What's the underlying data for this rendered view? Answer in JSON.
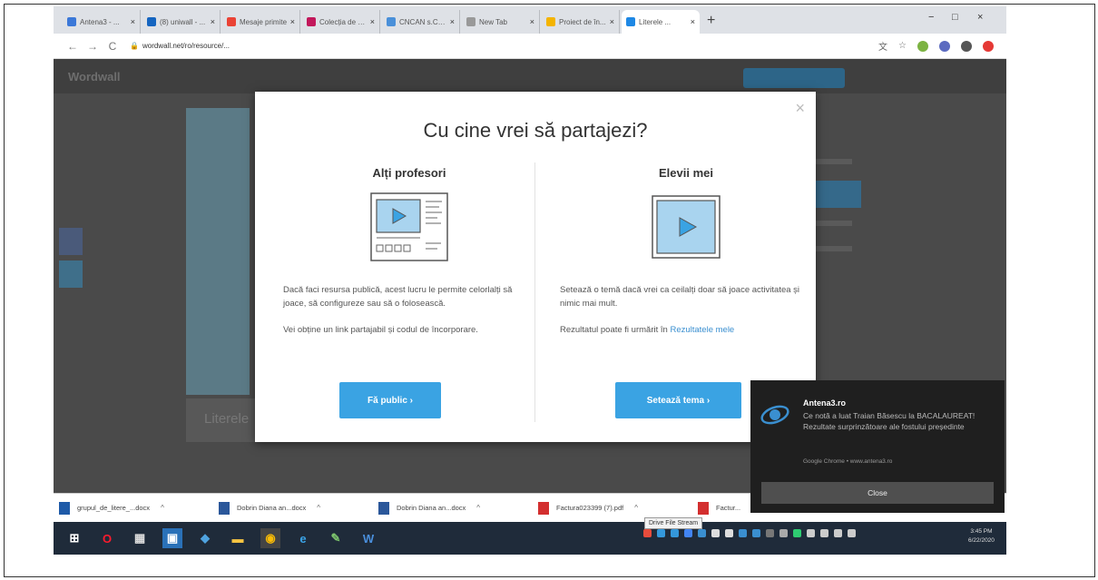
{
  "browser": {
    "tabs": [
      {
        "label": "Antena3 - ...",
        "color": "#3b78d8"
      },
      {
        "label": "(8) uniwall - ...",
        "color": "#1565c0"
      },
      {
        "label": "Mesaje primite",
        "color": "#ea4335"
      },
      {
        "label": "Colecția de c...",
        "color": "#c2185b"
      },
      {
        "label": "CNCAN s.CN...",
        "color": "#4a90d9"
      },
      {
        "label": "New Tab",
        "color": "#999999"
      },
      {
        "label": "Proiect de în...",
        "color": "#f4b400"
      },
      {
        "label": "Literele ...",
        "color": "#1e88e5"
      }
    ],
    "new_tab_symbol": "+",
    "url": "wordwall.net/ro/resource/...",
    "nav": {
      "back": "←",
      "forward": "→",
      "reload": "C"
    },
    "window": {
      "minimize": "−",
      "maximize": "□",
      "close": "×"
    }
  },
  "page": {
    "logo": "Wordwall",
    "bg_title": "Literele"
  },
  "modal": {
    "title": "Cu cine vrei să partajezi?",
    "close_symbol": "×",
    "left": {
      "heading": "Alți profesori",
      "text1": "Dacă faci resursa publică, acest lucru le permite celorlalți să joace, să configureze sau să o folosească.",
      "text2": "Vei obține un link partajabil și codul de încorporare.",
      "button": "Fă public ›"
    },
    "right": {
      "heading": "Elevii mei",
      "text1": "Setează o temă dacă vrei ca ceilalți doar să joace activitatea și nimic mai mult.",
      "text2_prefix": "Rezultatul poate fi urmărit în ",
      "text2_link": "Rezultatele mele",
      "button": "Setează tema ›"
    }
  },
  "downloads": [
    {
      "name": "grupul_de_litere_...docx",
      "color": "#1e5aa8"
    },
    {
      "name": "Dobrin Diana an...docx",
      "color": "#2b579a"
    },
    {
      "name": "Dobrin Diana an...docx",
      "color": "#2b579a"
    },
    {
      "name": "Factura023399 (7).pdf",
      "color": "#d32f2f"
    },
    {
      "name": "Factur...",
      "color": "#d32f2f"
    }
  ],
  "taskbar": {
    "tooltip": "Drive File Stream",
    "clock_time": "3:45 PM",
    "clock_date": "6/22/2020"
  },
  "notification": {
    "title": "Antena3.ro",
    "body": "Ce notă a luat Traian Băsescu la BACALAUREAT! Rezultate surprinzătoare ale fostului președinte",
    "source": "Google Chrome • www.antena3.ro",
    "button": "Close"
  }
}
